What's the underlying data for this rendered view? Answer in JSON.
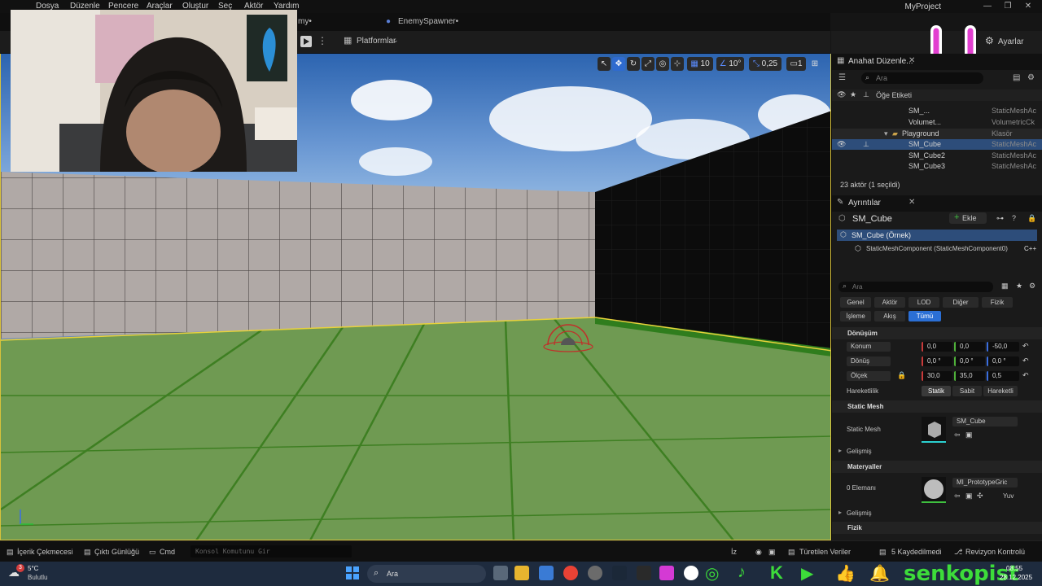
{
  "menu": {
    "items": [
      "Dosya",
      "Düzenle",
      "Pencere",
      "Araçlar",
      "Oluştur",
      "Seç",
      "Aktör",
      "Yardım"
    ],
    "project": "MyProject"
  },
  "tabs": {
    "partial": "my•",
    "enemy": "EnemySpawner•"
  },
  "toolbar": {
    "platforms": "Platformlar",
    "settings": "Ayarlar"
  },
  "viewport": {
    "grid_value": "10",
    "angle_value": "10°",
    "scale_value": "0,25",
    "camera_value": "1"
  },
  "outliner": {
    "tab": "Anahat Düzenle...",
    "search_placeholder": "Ara",
    "column_label": "Öğe Etiketi",
    "rows": [
      {
        "name": "SM_...",
        "type": "StaticMeshAc"
      },
      {
        "name": "Volumet...",
        "type": "VolumetricCk"
      },
      {
        "name": "Playground",
        "type": "Klasör"
      },
      {
        "name": "SM_Cube",
        "type": "StaticMeshAc"
      },
      {
        "name": "SM_Cube2",
        "type": "StaticMeshAc"
      },
      {
        "name": "SM_Cube3",
        "type": "StaticMeshAc"
      }
    ],
    "count": "23 aktör (1 seçildi)"
  },
  "details": {
    "tab": "Ayrıntılar",
    "object": "SM_Cube",
    "add": "Ekle",
    "instance": "SM_Cube (Örnek)",
    "component": "StaticMeshComponent (StaticMeshComponent0)",
    "component_suffix": "C++",
    "search_placeholder": "Ara",
    "filters": [
      "Genel",
      "Aktör",
      "LOD",
      "Diğer",
      "Fizik",
      "İşleme",
      "Akış",
      "Tümü"
    ],
    "transform": {
      "title": "Dönüşüm",
      "location": {
        "label": "Konum",
        "x": "0,0",
        "y": "0,0",
        "z": "-50,0"
      },
      "rotation": {
        "label": "Dönüş",
        "x": "0,0 °",
        "y": "0,0 °",
        "z": "0,0 °"
      },
      "scale": {
        "label": "Ölçek",
        "x": "30,0",
        "y": "35,0",
        "z": "0,5"
      },
      "mobility": {
        "label": "Hareketlilik",
        "options": [
          "Statik",
          "Sabit",
          "Hareketli"
        ],
        "selected": "Statik"
      }
    },
    "static_mesh": {
      "title": "Static Mesh",
      "label": "Static Mesh",
      "value": "SM_Cube",
      "advanced": "Gelişmiş"
    },
    "materials": {
      "title": "Materyaller",
      "element": "0 Elemanı",
      "value": "MI_PrototypeGric",
      "extra": "Yuv",
      "advanced": "Gelişmiş"
    },
    "physics": {
      "title": "Fizik"
    }
  },
  "bottombar": {
    "content": "İçerik Çekmecesi",
    "output": "Çıktı Günlüğü",
    "cmd": "Cmd",
    "console_placeholder": "Konsol Komutunu Gir",
    "iz": "İz",
    "derived": "Türetilen Veriler",
    "saved": "5 Kaydedilmedi",
    "revision": "Revizyon Kontrolü"
  },
  "taskbar": {
    "weather_temp": "5°C",
    "weather_desc": "Bulutlu",
    "weather_badge": "3",
    "search": "Ara",
    "time": "08:55",
    "date": "28.12.2025",
    "brand": "senkopist",
    "brand_color": "#3ddc3a"
  }
}
